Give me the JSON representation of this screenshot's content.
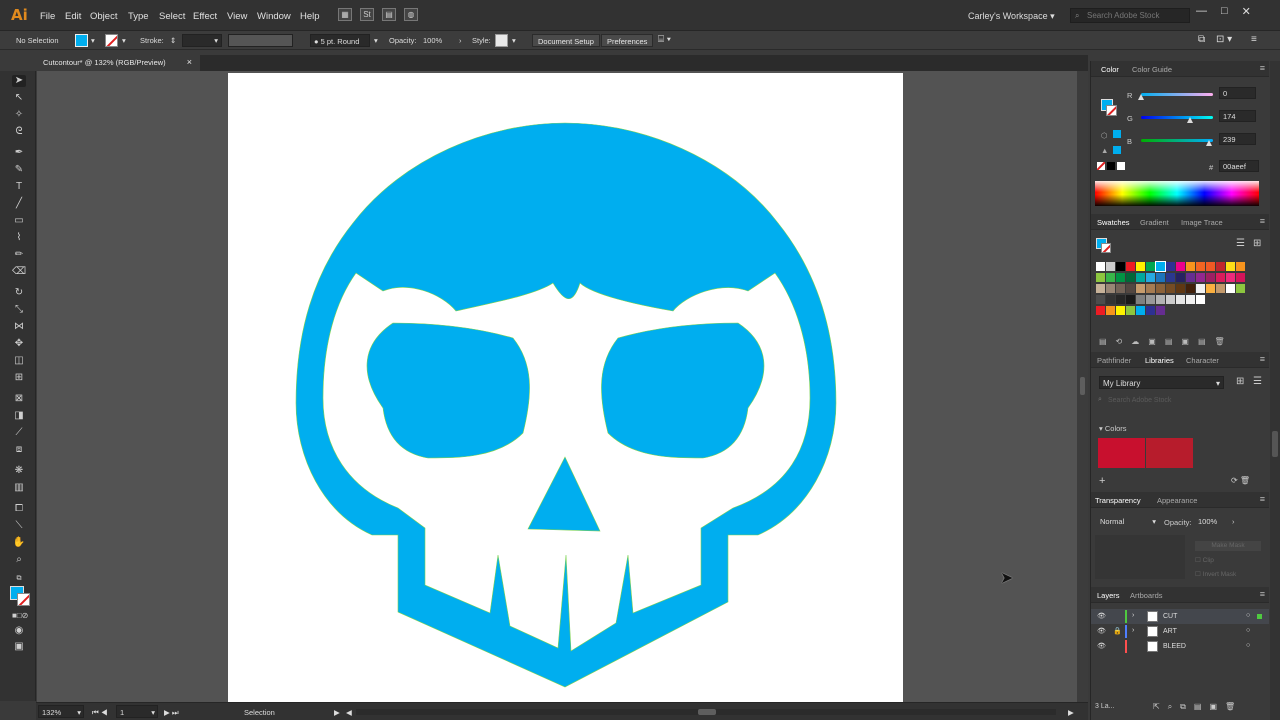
{
  "app": {
    "logo": "Ai",
    "workspace": "Carley's Workspace",
    "stock_search_placeholder": "Search Adobe Stock",
    "window_buttons": [
      "—",
      "□",
      "✕"
    ]
  },
  "menus": [
    "File",
    "Edit",
    "Object",
    "Type",
    "Select",
    "Effect",
    "View",
    "Window",
    "Help"
  ],
  "control_bar": {
    "selection": "No Selection",
    "fill_color": "#00aeef",
    "stroke_label": "Stroke:",
    "brush": "5 pt. Round",
    "opacity_label": "Opacity:",
    "opacity_value": "100%",
    "style_label": "Style:",
    "document_setup": "Document Setup",
    "preferences": "Preferences"
  },
  "document": {
    "tab_title": "Cutcontour* @ 132% (RGB/Preview)",
    "close": "×"
  },
  "artwork": {
    "color": "#00aeef"
  },
  "status": {
    "zoom": "132%",
    "artboard": "1",
    "tool": "Selection"
  },
  "color_panel": {
    "tabs": [
      "Color",
      "Color Guide"
    ],
    "channels": [
      {
        "label": "R",
        "value": "0",
        "fraction": 0.0
      },
      {
        "label": "G",
        "value": "174",
        "fraction": 0.68
      },
      {
        "label": "B",
        "value": "239",
        "fraction": 0.94
      }
    ],
    "hex_label": "#",
    "hex": "00aeef"
  },
  "swatches_panel": {
    "tabs": [
      "Swatches",
      "Gradient",
      "Image Trace"
    ],
    "rows": [
      [
        "#ffffff",
        "#cccccc",
        "#000000",
        "#ed1c24",
        "#fff200",
        "#00a651",
        "#00aeef",
        "#2e3192",
        "#ec008c",
        "#f7941d",
        "#f26522",
        "#f15a24",
        "#c1272d",
        "#ffde17",
        "#f7941d"
      ],
      [
        "#8dc63f",
        "#39b54a",
        "#009444",
        "#006838",
        "#00a99d",
        "#27aae1",
        "#1c75bc",
        "#2b388f",
        "#262262",
        "#662d91",
        "#92278f",
        "#9e1f63",
        "#da1c5c",
        "#ee2a7b",
        "#d4145a"
      ],
      [
        "#c7b299",
        "#998675",
        "#736357",
        "#534741",
        "#c69c6d",
        "#a67c52",
        "#8c6239",
        "#754c24",
        "#603813",
        "#42210b",
        "#f2f2f2",
        "#fbb040",
        "#c49a6c",
        "#ffffff",
        "#8dc63f"
      ],
      [
        "#4d4d4d",
        "#333333",
        "#262626",
        "#1a1a1a",
        "#808080",
        "#999999",
        "#b3b3b3",
        "#cccccc",
        "#e6e6e6",
        "#f2f2f2",
        "#ffffff"
      ],
      [
        "#ed1c24",
        "#f7941d",
        "#fff200",
        "#8dc63f",
        "#00aeef",
        "#2e3192",
        "#662d91"
      ]
    ]
  },
  "libraries_panel": {
    "tabs": [
      "Pathfinder",
      "Libraries",
      "Character"
    ],
    "library": "My Library",
    "search_placeholder": "Search Adobe Stock",
    "section": "Colors",
    "colors": [
      "#c8102e",
      "#b71c2c"
    ]
  },
  "transparency_panel": {
    "tabs": [
      "Transparency",
      "Appearance"
    ],
    "blend_mode": "Normal",
    "opacity_label": "Opacity:",
    "opacity_value": "100%",
    "make_mask": "Make Mask",
    "clip": "Clip",
    "invert_mask": "Invert Mask"
  },
  "layers_panel": {
    "tabs": [
      "Layers",
      "Artboards"
    ],
    "layers": [
      {
        "name": "CUT",
        "color": "#4fc940",
        "locked": false
      },
      {
        "name": "ART",
        "color": "#4f7fff",
        "locked": true
      },
      {
        "name": "BLEED",
        "color": "#ff4f4f",
        "locked": false
      }
    ],
    "count": "3 La..."
  }
}
